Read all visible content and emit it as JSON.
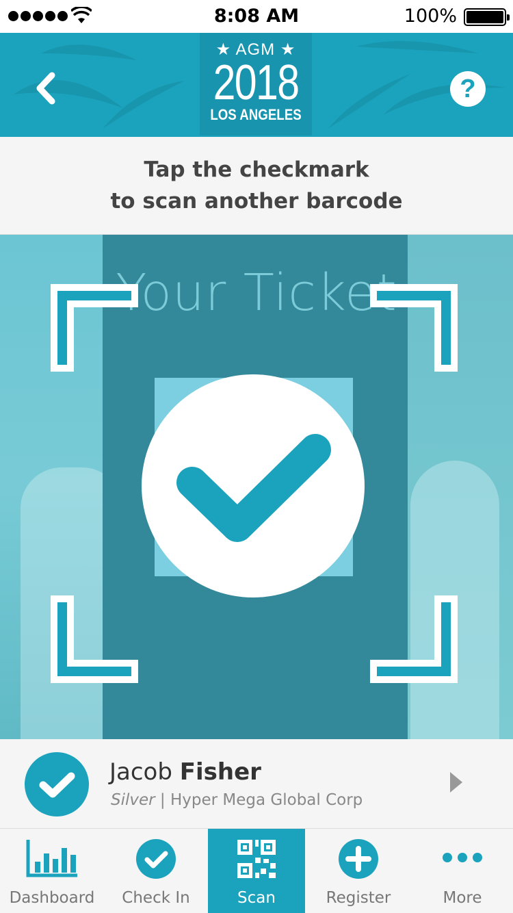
{
  "status_bar": {
    "time": "8:08 AM",
    "battery": "100%"
  },
  "header": {
    "logo_top": "★ AGM ★",
    "logo_year": "2018",
    "logo_city": "LOS ANGELES",
    "help_label": "?"
  },
  "instruction": {
    "line1": "Tap the checkmark",
    "line2": "to scan another barcode"
  },
  "scanner": {
    "ticket_title": "Your Ticket"
  },
  "attendee": {
    "first_name": "Jacob",
    "last_name": "Fisher",
    "tier": "Silver",
    "separator": " | ",
    "company": "Hyper Mega Global Corp"
  },
  "tabs": [
    {
      "label": "Dashboard",
      "icon": "bar-chart-icon"
    },
    {
      "label": "Check In",
      "icon": "checkmark-circle-icon"
    },
    {
      "label": "Scan",
      "icon": "qr-code-icon"
    },
    {
      "label": "Register",
      "icon": "plus-circle-icon"
    },
    {
      "label": "More",
      "icon": "ellipsis-icon"
    }
  ],
  "colors": {
    "accent": "#1ba3bd",
    "scanner_screen": "#33889a"
  }
}
